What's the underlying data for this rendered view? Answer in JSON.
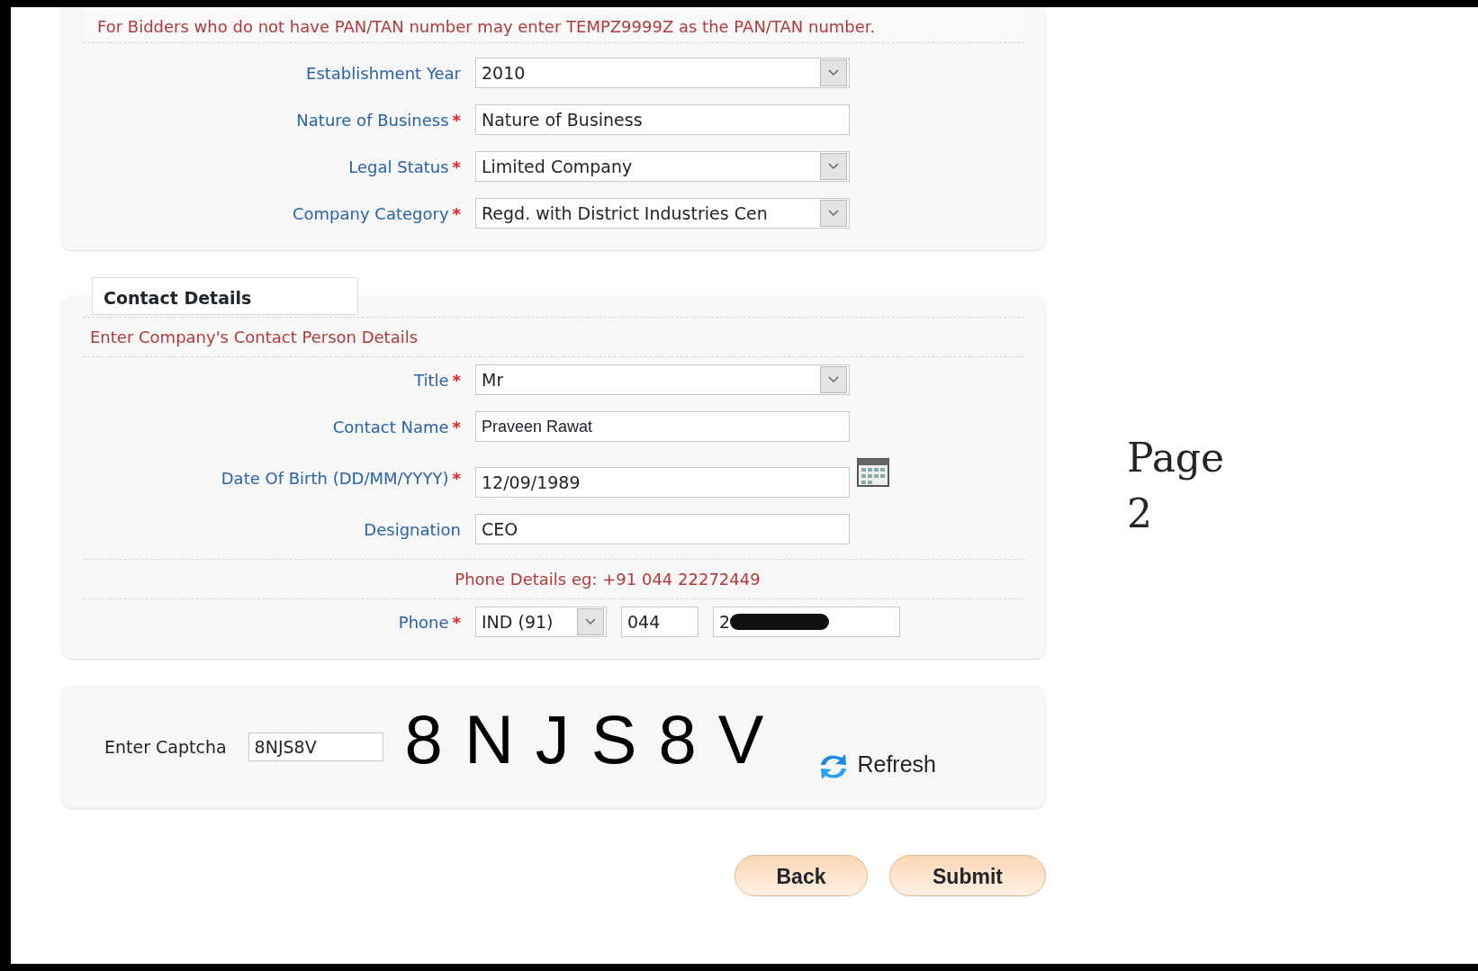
{
  "notice": "For Bidders who do not have PAN/TAN number may enter TEMPZ9999Z as the PAN/TAN number.",
  "company_fields": [
    {
      "label": "Establishment Year",
      "kind": "select",
      "value": "2010"
    },
    {
      "label": "Nature of Business",
      "required_mark": "*",
      "kind": "text",
      "value": "Nature of Business"
    },
    {
      "label": "Legal Status",
      "required_mark": "*",
      "kind": "select",
      "value": "Limited Company"
    },
    {
      "label": "Company Category",
      "required_mark": "*",
      "kind": "select",
      "value": "Regd. with District Industries Cen"
    }
  ],
  "contact_section": {
    "title": "Contact Details",
    "subtitle": "Enter Company's Contact Person Details",
    "fields": [
      {
        "label": "Title",
        "required_mark": "*",
        "kind": "select",
        "value": "Mr"
      },
      {
        "label": "Contact Name",
        "required_mark": "*",
        "kind": "text",
        "value": "Praveen Rawat"
      },
      {
        "label": "Date Of Birth (DD/MM/YYYY)",
        "required_mark": "*",
        "kind": "date",
        "value": "12/09/1989"
      },
      {
        "label": "Designation",
        "kind": "text",
        "value": "CEO"
      }
    ],
    "phone_hint": "Phone Details eg: +91 044 22272449",
    "phone": {
      "label": "Phone",
      "required_mark": "*",
      "country": "IND (91)",
      "area_code": "044",
      "number": "2",
      "redacted": true
    }
  },
  "captcha": {
    "label": "Enter Captcha",
    "value": "8NJS8V",
    "image_chars": [
      "8",
      "N",
      "J",
      "S",
      "8",
      "V"
    ],
    "refresh": "Refresh"
  },
  "buttons": [
    "Back",
    "Submit"
  ],
  "page_label": "Page 2"
}
